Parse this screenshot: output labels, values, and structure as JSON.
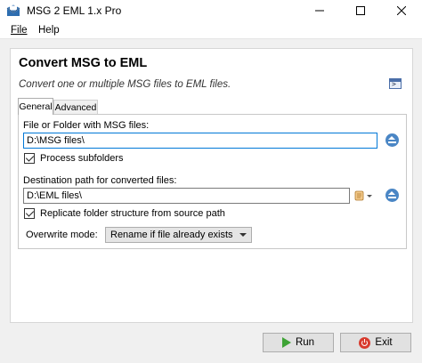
{
  "window": {
    "title": "MSG 2 EML 1.x Pro"
  },
  "menu": {
    "file": "File",
    "help": "Help"
  },
  "main": {
    "heading": "Convert MSG to EML",
    "subtitle": "Convert one or multiple MSG files to EML files."
  },
  "tabs": [
    {
      "label": "General"
    },
    {
      "label": "Advanced"
    }
  ],
  "general": {
    "source_label": "File or Folder with MSG files:",
    "source_value": "D:\\MSG files\\",
    "process_subfolders_label": "Process subfolders",
    "process_subfolders_checked": true,
    "destination_label": "Destination path for converted files:",
    "destination_value": "D:\\EML files\\",
    "replicate_label": "Replicate folder structure from source path",
    "replicate_checked": true,
    "overwrite_label": "Overwrite mode:",
    "overwrite_value": "Rename if file already exists"
  },
  "buttons": {
    "run": "Run",
    "exit": "Exit"
  },
  "icons": {
    "app": "envelope-app-icon",
    "minimize": "minimize-icon",
    "maximize": "maximize-icon",
    "close": "close-icon",
    "console": "console-icon",
    "eject": "eject-icon",
    "scroll": "scroll-icon",
    "run": "play-icon",
    "exit": "power-icon"
  },
  "colors": {
    "accent": "#0078d7",
    "eject": "#4a86c5",
    "run": "#3ea335",
    "exit": "#d83b2e"
  }
}
